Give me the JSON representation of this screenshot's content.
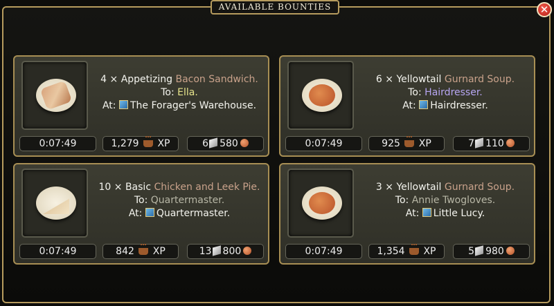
{
  "header": {
    "title": "AVAILABLE BOUNTIES",
    "close_glyph": "✕"
  },
  "bounties": [
    {
      "qty": "4 ×",
      "quality": "Appetizing",
      "item": "Bacon Sandwich.",
      "to_label": "To:",
      "recipient": "Ella.",
      "recipient_color": "yellow",
      "at_label": "At:",
      "location": "The Forager's Warehouse.",
      "image": "sandwich",
      "timer": "0:07:49",
      "xp": "1,279",
      "xp_label": "XP",
      "ingots": "6",
      "coins": "580"
    },
    {
      "qty": "6 ×",
      "quality": "Yellowtail",
      "item": "Gurnard Soup.",
      "to_label": "To:",
      "recipient": "Hairdresser.",
      "recipient_color": "purple",
      "at_label": "At:",
      "location": "Hairdresser.",
      "image": "soup",
      "timer": "0:07:49",
      "xp": "925",
      "xp_label": "XP",
      "ingots": "7",
      "coins": "110"
    },
    {
      "qty": "10 ×",
      "quality": "Basic",
      "item": "Chicken and Leek Pie.",
      "to_label": "To:",
      "recipient": "Quartermaster.",
      "recipient_color": "grey",
      "at_label": "At:",
      "location": "Quartermaster.",
      "image": "pie",
      "timer": "0:07:49",
      "xp": "842",
      "xp_label": "XP",
      "ingots": "13",
      "coins": "800"
    },
    {
      "qty": "3 ×",
      "quality": "Yellowtail",
      "item": "Gurnard Soup.",
      "to_label": "To:",
      "recipient": "Annie Twogloves.",
      "recipient_color": "grey",
      "at_label": "At:",
      "location": "Little Lucy.",
      "image": "soup",
      "timer": "0:07:49",
      "xp": "1,354",
      "xp_label": "XP",
      "ingots": "5",
      "coins": "980"
    }
  ]
}
